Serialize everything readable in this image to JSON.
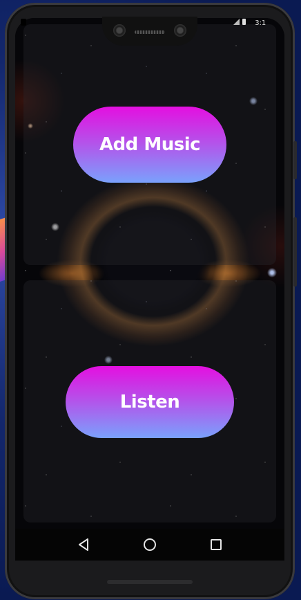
{
  "status_bar": {
    "time": "3:1",
    "icons": [
      "signal-icon",
      "battery-icon"
    ]
  },
  "main": {
    "add_music_label": "Add Music",
    "listen_label": "Listen"
  },
  "nav_bar": {
    "icons": [
      "back-triangle-icon",
      "home-circle-icon",
      "recents-square-icon"
    ]
  },
  "colors": {
    "button_gradient_top": "#e40fe0",
    "button_gradient_mid": "#b453ea",
    "button_gradient_bottom": "#7aa1fc",
    "button_text": "#ffffff",
    "background": "#060609"
  }
}
